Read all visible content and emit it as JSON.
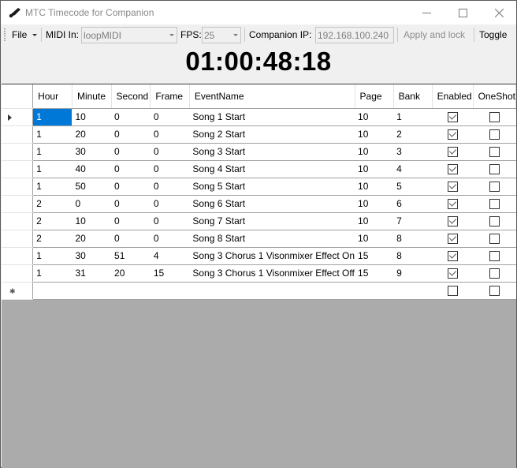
{
  "window": {
    "title": "MTC Timecode for Companion",
    "icon": "app-logo-icon",
    "controls": [
      "minimize-icon",
      "maximize-icon",
      "close-icon"
    ]
  },
  "toolbar": {
    "file_label": "File",
    "midi_in_label": "MIDI In:",
    "midi_in_value": "loopMIDI",
    "fps_label": "FPS:",
    "fps_value": "25",
    "companion_ip_label": "Companion IP:",
    "companion_ip_value": "192.168.100.240",
    "apply_label": "Apply and lock",
    "toggle_label": "Toggle"
  },
  "timecode": "01:00:48:18",
  "grid": {
    "columns": [
      "Hour",
      "Minute",
      "Second",
      "Frame",
      "EventName",
      "Page",
      "Bank",
      "Enabled",
      "OneShot"
    ],
    "rows": [
      {
        "hour": "1",
        "minute": "10",
        "second": "0",
        "frame": "0",
        "event": "Song 1 Start",
        "page": "10",
        "bank": "1",
        "enabled": true,
        "oneshot": false,
        "current": true
      },
      {
        "hour": "1",
        "minute": "20",
        "second": "0",
        "frame": "0",
        "event": "Song 2 Start",
        "page": "10",
        "bank": "2",
        "enabled": true,
        "oneshot": false
      },
      {
        "hour": "1",
        "minute": "30",
        "second": "0",
        "frame": "0",
        "event": "Song 3 Start",
        "page": "10",
        "bank": "3",
        "enabled": true,
        "oneshot": false
      },
      {
        "hour": "1",
        "minute": "40",
        "second": "0",
        "frame": "0",
        "event": "Song 4 Start",
        "page": "10",
        "bank": "4",
        "enabled": true,
        "oneshot": false
      },
      {
        "hour": "1",
        "minute": "50",
        "second": "0",
        "frame": "0",
        "event": "Song 5 Start",
        "page": "10",
        "bank": "5",
        "enabled": true,
        "oneshot": false
      },
      {
        "hour": "2",
        "minute": "0",
        "second": "0",
        "frame": "0",
        "event": "Song 6 Start",
        "page": "10",
        "bank": "6",
        "enabled": true,
        "oneshot": false
      },
      {
        "hour": "2",
        "minute": "10",
        "second": "0",
        "frame": "0",
        "event": "Song 7 Start",
        "page": "10",
        "bank": "7",
        "enabled": true,
        "oneshot": false
      },
      {
        "hour": "2",
        "minute": "20",
        "second": "0",
        "frame": "0",
        "event": "Song 8 Start",
        "page": "10",
        "bank": "8",
        "enabled": true,
        "oneshot": false
      },
      {
        "hour": "1",
        "minute": "30",
        "second": "51",
        "frame": "4",
        "event": "Song 3 Chorus 1 Visonmixer Effect On",
        "page": "15",
        "bank": "8",
        "enabled": true,
        "oneshot": false
      },
      {
        "hour": "1",
        "minute": "31",
        "second": "20",
        "frame": "15",
        "event": "Song 3 Chorus 1 Visonmixer Effect Off",
        "page": "15",
        "bank": "9",
        "enabled": true,
        "oneshot": false
      }
    ],
    "new_row": {
      "enabled": false,
      "oneshot": false
    }
  },
  "colors": {
    "selection": "#0078d7",
    "empty_area": "#ababab"
  }
}
